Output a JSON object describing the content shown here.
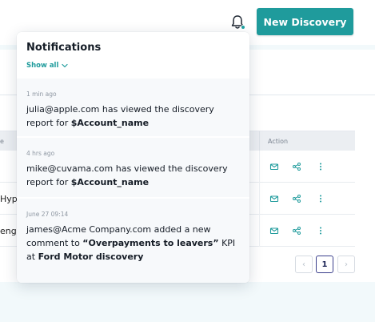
{
  "header": {
    "new_button_label": "New Discovery",
    "accent_color": "#1f9b9c"
  },
  "table": {
    "left_header": "e",
    "action_header": "Action",
    "rows": [
      {
        "left": ""
      },
      {
        "left": "Hyp"
      },
      {
        "left": "enge"
      }
    ]
  },
  "pagination": {
    "prev": "‹",
    "current": "1",
    "next": "›"
  },
  "notifications": {
    "title": "Notifications",
    "show_all": "Show all",
    "items": [
      {
        "time": "1 min ago",
        "text_pre": "julia@apple.com has viewed the discovery report for ",
        "bold1": "$Account_name",
        "text_mid": "",
        "bold2": "",
        "text_post": ""
      },
      {
        "time": "4 hrs ago",
        "text_pre": "mike@cuvama.com has viewed the discovery report for ",
        "bold1": "$Account_name",
        "text_mid": "",
        "bold2": "",
        "text_post": ""
      },
      {
        "time": "June 27 09:14",
        "text_pre": "james@Acme Company.com added a new comment to ",
        "bold1": "“Overpayments to leavers”",
        "text_mid": " KPI at ",
        "bold2": "Ford Motor discovery",
        "text_post": ""
      }
    ]
  }
}
